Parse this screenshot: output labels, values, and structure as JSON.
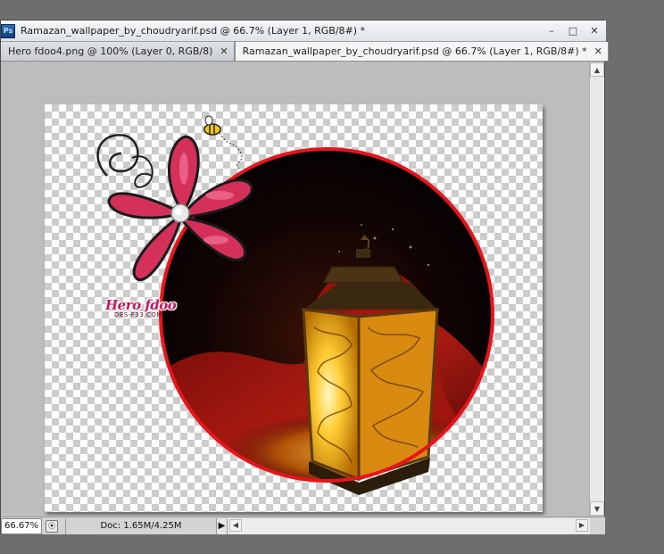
{
  "window": {
    "app_icon": "Ps",
    "title": "Ramazan_wallpaper_by_choudryarif.psd @ 66.7% (Layer 1, RGB/8#) *",
    "controls": {
      "minimize": "–",
      "maximize": "□",
      "close": "✕"
    }
  },
  "tabs": [
    {
      "label": "Hero fdoo4.png @ 100% (Layer 0, RGB/8)",
      "close": "✕",
      "active": false
    },
    {
      "label": "Ramazan_wallpaper_by_choudryarif.psd @ 66.7% (Layer 1, RGB/8#) *",
      "close": "✕",
      "active": true
    }
  ],
  "artwork": {
    "watermark_text": "Hero fdoo",
    "watermark_sub": "DES-F33.COM",
    "ring_color": "#e8141c",
    "flower_color": "#d4305a"
  },
  "status": {
    "zoom": "66.67%",
    "doc_info": "Doc: 1.65M/4.25M",
    "arrow": "▶"
  },
  "scroll": {
    "up": "▲",
    "down": "▼",
    "left": "◀",
    "right": "▶"
  }
}
